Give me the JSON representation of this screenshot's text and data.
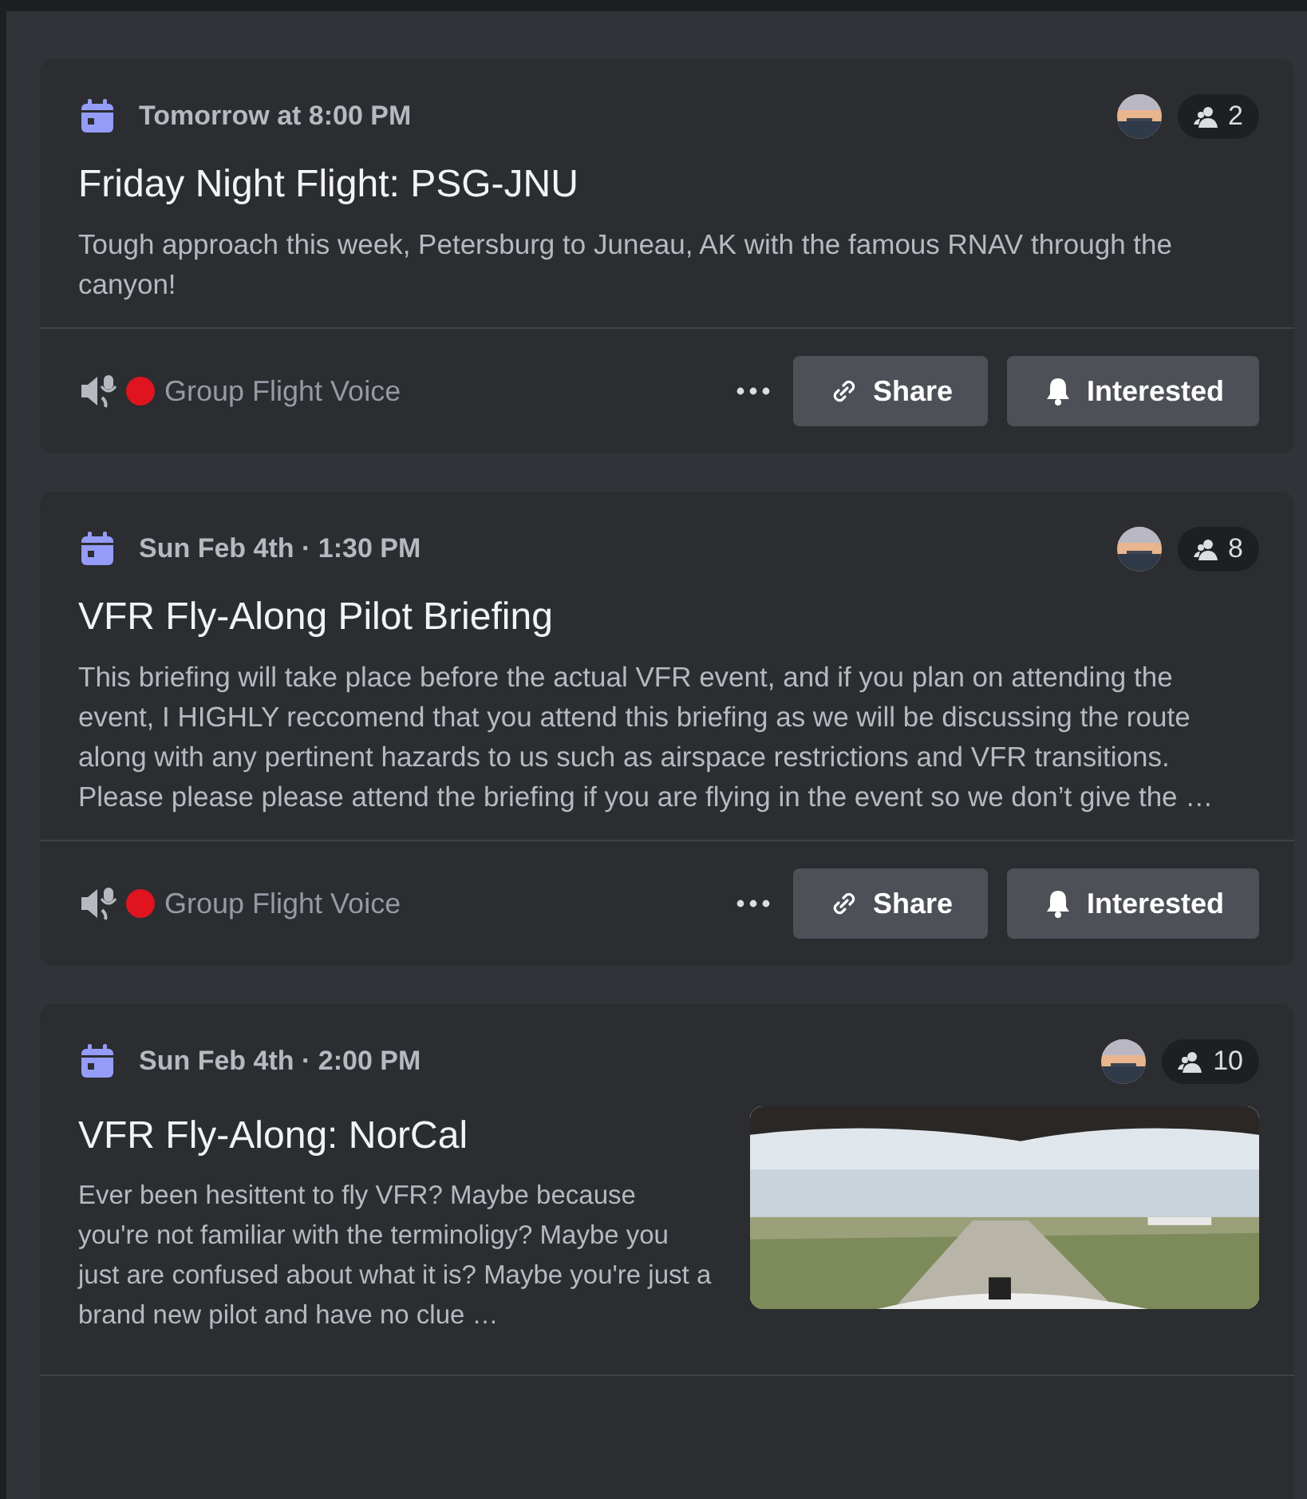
{
  "events": [
    {
      "date": "Tomorrow at 8:00 PM",
      "title": "Friday Night Flight: PSG-JNU",
      "description": "Tough approach this week, Petersburg to Juneau, AK with the famous RNAV through the canyon!",
      "interested_count": "2",
      "channel": {
        "name": "Group Flight Voice"
      },
      "buttons": [
        {
          "kind": "share",
          "label": "Share"
        },
        {
          "kind": "interested",
          "label": "Interested"
        }
      ]
    },
    {
      "date": "Sun Feb 4th · 1:30 PM",
      "title": "VFR Fly-Along Pilot Briefing",
      "description": "This briefing will take place before the actual VFR event, and if you plan on attending the event, I HIGHLY reccomend that you attend this briefing as we will be discussing the route along with any pertinent hazards to us such as airspace restrictions and VFR transitions. Please please please attend the briefing if you are flying in the event so we don’t give the …",
      "interested_count": "8",
      "channel": {
        "name": "Group Flight Voice"
      },
      "buttons": [
        {
          "kind": "share",
          "label": "Share"
        },
        {
          "kind": "interested",
          "label": "Interested"
        }
      ]
    },
    {
      "date": "Sun Feb 4th · 2:00 PM",
      "title": "VFR Fly-Along: NorCal",
      "description": "Ever been hesittent to fly VFR? Maybe because you're not familiar with the terminoligy? Maybe you just are confused about what it is? Maybe you're just a brand new pilot and have no clue …",
      "interested_count": "10"
    }
  ]
}
